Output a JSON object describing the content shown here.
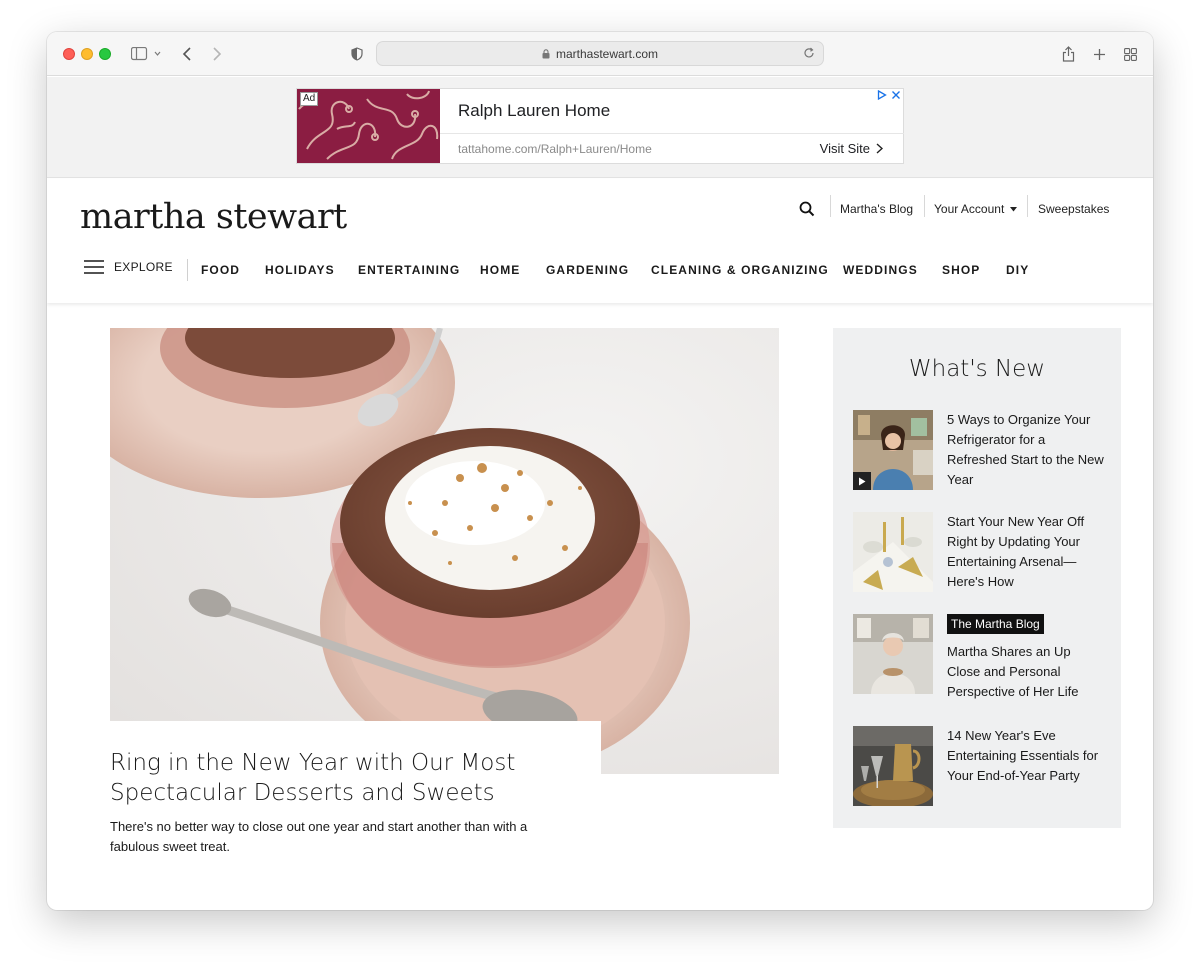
{
  "browser": {
    "url": "marthastewart.com"
  },
  "ad": {
    "badge": "Ad",
    "title": "Ralph Lauren Home",
    "url": "tattahome.com/Ralph+Lauren/Home",
    "cta": "Visit Site"
  },
  "header": {
    "logo": "martha stewart",
    "utility": {
      "blog": "Martha's Blog",
      "account": "Your Account",
      "sweepstakes": "Sweepstakes"
    },
    "explore": "EXPLORE",
    "nav": [
      "FOOD",
      "HOLIDAYS",
      "ENTERTAINING",
      "HOME",
      "GARDENING",
      "CLEANING & ORGANIZING",
      "WEDDINGS",
      "SHOP",
      "DIY"
    ]
  },
  "hero": {
    "title": "Ring in the New Year with Our Most Spectacular Desserts and Sweets",
    "description": "There's no better way to close out one year and start another than with a fabulous sweet treat."
  },
  "sidebar": {
    "title": "What's New",
    "items": [
      {
        "badge": "",
        "text": "5 Ways to Organize Your Refrigerator for a Refreshed Start to the New Year"
      },
      {
        "badge": "",
        "text": "Start Your New Year Off Right by Updating Your Entertaining Arsenal—Here's How"
      },
      {
        "badge": "The Martha Blog",
        "text": "Martha Shares an Up Close and Personal Perspective of Her Life"
      },
      {
        "badge": "",
        "text": "14 New Year's Eve Entertaining Essentials for Your End-of-Year Party"
      }
    ]
  },
  "colors": {
    "accent": "#111111",
    "sidebar_bg": "#eff0f1"
  }
}
